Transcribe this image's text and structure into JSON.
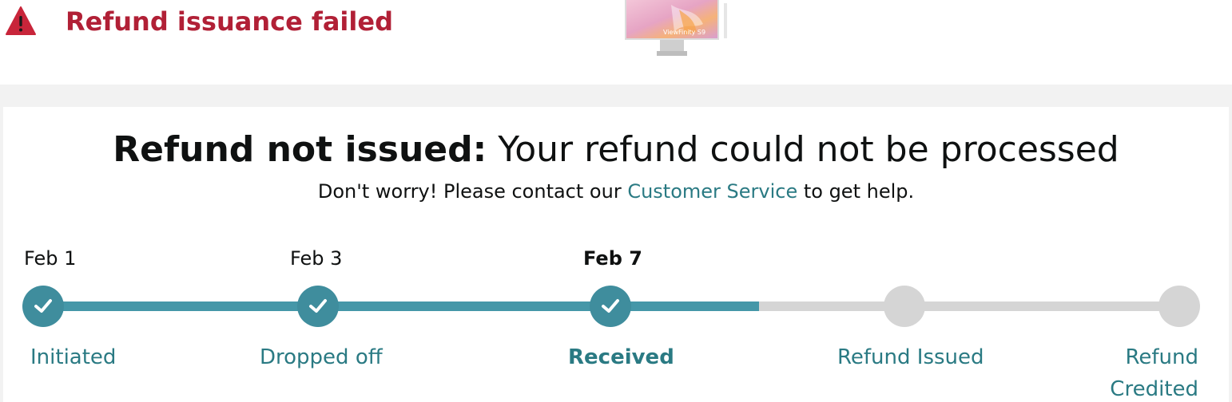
{
  "alert": {
    "title": "Refund issuance failed",
    "icon": "warning-triangle-icon",
    "color": "#b12036"
  },
  "product": {
    "brand_text": "ViewFinity S9"
  },
  "status": {
    "headline_bold": "Refund not issued:",
    "headline_rest": " Your refund could not be processed",
    "sub_before": "Don't worry! Please contact our ",
    "sub_link": "Customer Service",
    "sub_after": " to get help."
  },
  "tracker": {
    "progress_color": "#4597a8",
    "pending_color": "#d5d5d5",
    "steps": [
      {
        "label": "Initiated",
        "date": "Feb 1",
        "state": "done"
      },
      {
        "label": "Dropped off",
        "date": "Feb 3",
        "state": "done"
      },
      {
        "label": "Received",
        "date": "Feb 7",
        "state": "current"
      },
      {
        "label": "Refund Issued",
        "date": "",
        "state": "pending"
      },
      {
        "label": "Refund Credited",
        "date": "",
        "state": "pending"
      }
    ]
  }
}
